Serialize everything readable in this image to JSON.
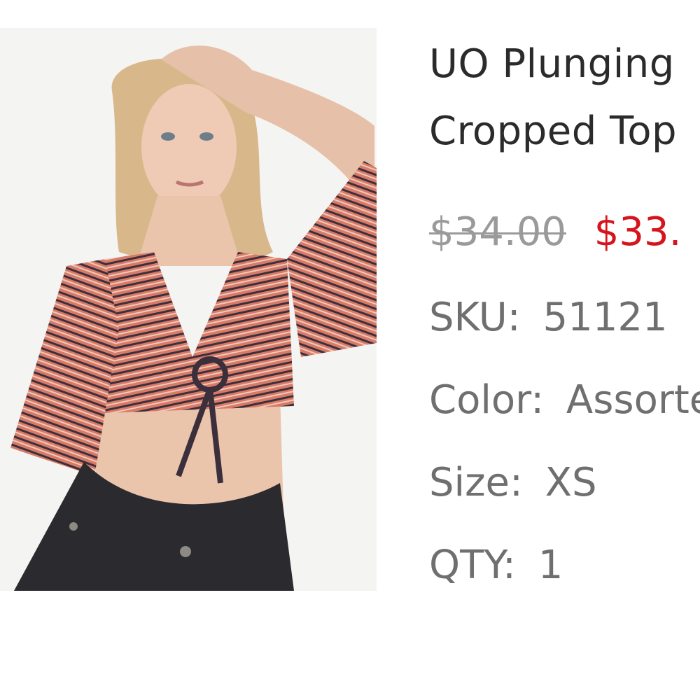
{
  "product": {
    "title_line1": "UO Plunging",
    "title_line2": "Cropped Top",
    "price_original": "$34.00",
    "price_sale": "$33.",
    "sku_label": "SKU:",
    "sku_value": "51121",
    "color_label": "Color:",
    "color_value": "Assorted",
    "size_label": "Size:",
    "size_value": "XS",
    "qty_label": "QTY:",
    "qty_value": "1"
  },
  "colors": {
    "title": "#2b2b2b",
    "price_original": "#9a9a9a",
    "price_sale": "#d6141c",
    "spec_text": "#6f6f6f"
  },
  "image": {
    "subject": "model-wearing-striped-cropped-top"
  }
}
